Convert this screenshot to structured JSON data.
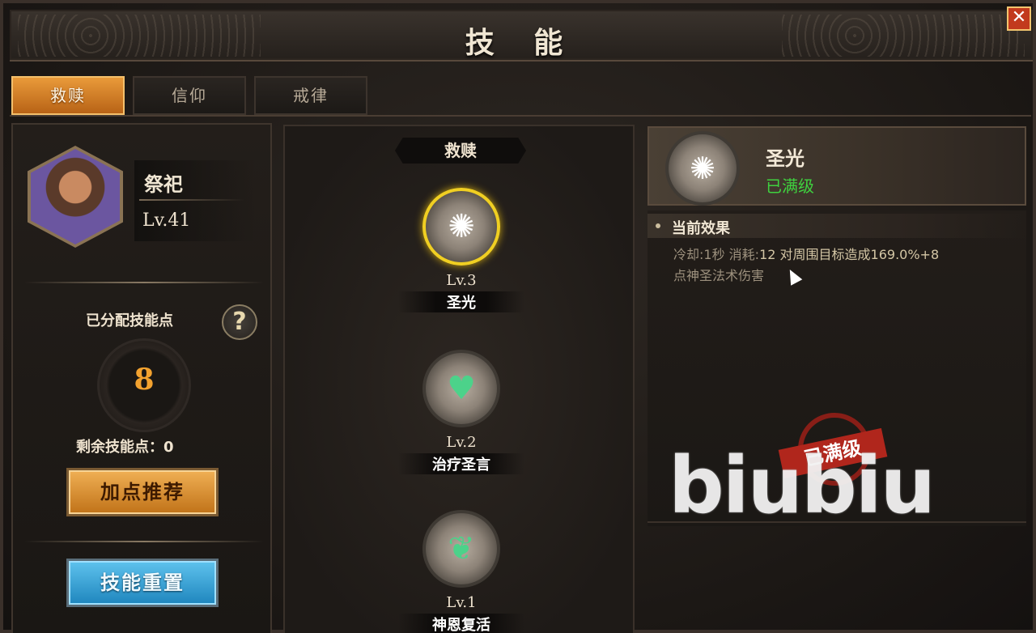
{
  "window": {
    "title": "技 能",
    "close_label": "✕"
  },
  "tabs": [
    {
      "label": "救赎",
      "active": true
    },
    {
      "label": "信仰",
      "active": false
    },
    {
      "label": "戒律",
      "active": false
    }
  ],
  "character": {
    "name": "祭祀",
    "level": "Lv.41"
  },
  "skill_points": {
    "allocated_label": "已分配技能点",
    "allocated_value": "8",
    "remaining_text": "剩余技能点：0",
    "help_label": "?"
  },
  "buttons": {
    "recommend": "加点推荐",
    "reset": "技能重置"
  },
  "branch": {
    "name": "救赎"
  },
  "skills": [
    {
      "name": "圣光",
      "level": "Lv.3",
      "icon": "holy-light-icon",
      "selected": true
    },
    {
      "name": "治疗圣言",
      "level": "Lv.2",
      "icon": "heart-heal-icon",
      "selected": false
    },
    {
      "name": "神恩复活",
      "level": "Lv.1",
      "icon": "angel-wings-icon",
      "selected": false
    }
  ],
  "detail": {
    "name": "圣光",
    "status": "已满级",
    "effect_header": "当前效果",
    "cooldown": "冷却:1秒",
    "cost_label": "消耗:",
    "cost_value": "12",
    "effect_text_1": "对周围目标造成169.0%+8",
    "effect_text_2": "点神圣法术伤害",
    "stamp": "已满级"
  },
  "watermark": "biubiu",
  "colors": {
    "accent_orange": "#e99a3a",
    "selected_ring": "#f0cf22",
    "maxed_green": "#3fd23f",
    "stamp_red": "#b0261c"
  }
}
